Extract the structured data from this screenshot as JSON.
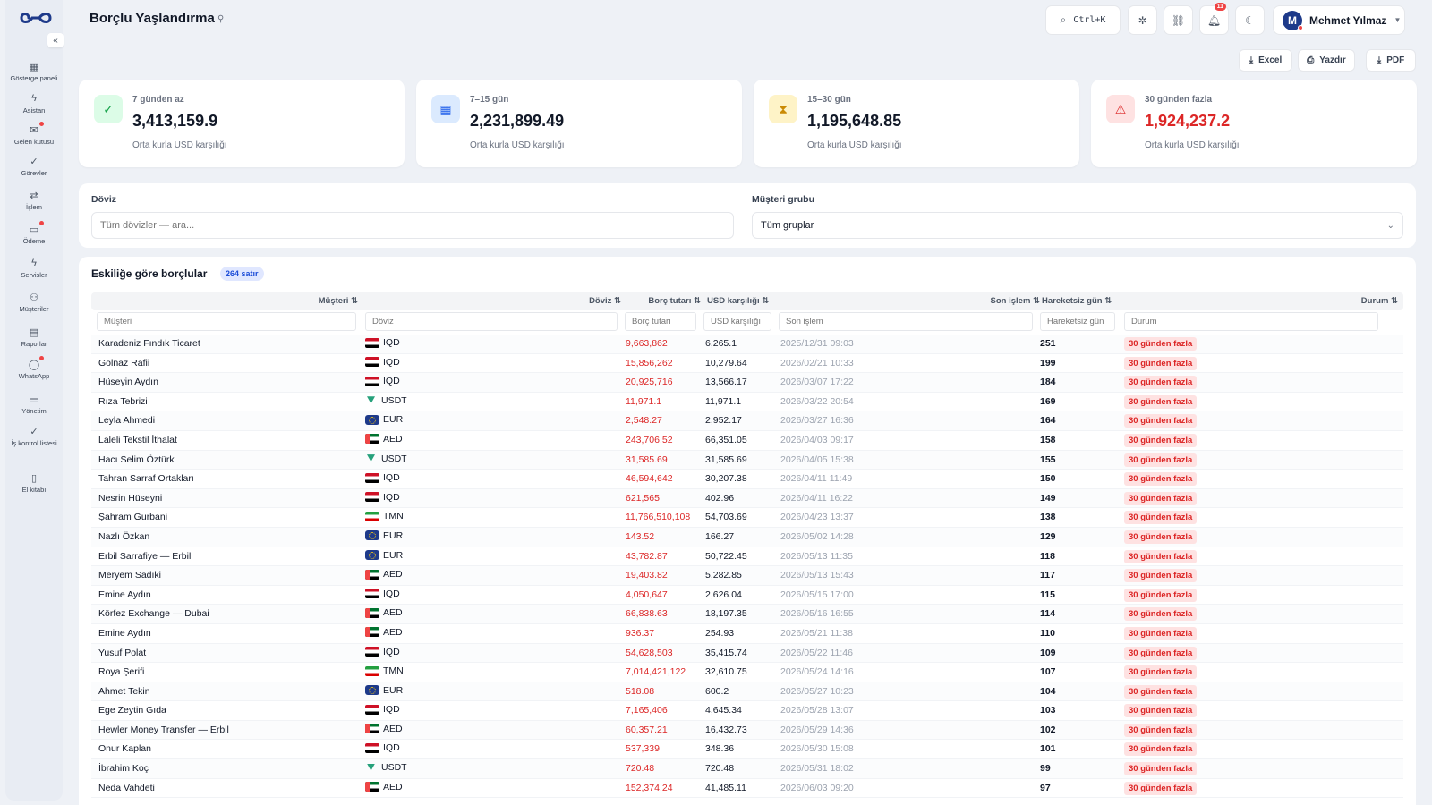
{
  "header": {
    "title": "Borçlu Yaşlandırma",
    "search_shortcut": "Ctrl+K",
    "notification_count": "11",
    "user_initial": "M",
    "user_name": "Mehmet Yılmaz"
  },
  "sidebar": {
    "items": [
      {
        "label": "Gösterge paneli",
        "icon": "grid-icon"
      },
      {
        "label": "Asistan",
        "icon": "bolt-icon"
      },
      {
        "label": "Gelen kutusu",
        "icon": "inbox-icon"
      },
      {
        "label": "Görevler",
        "icon": "check-icon"
      },
      {
        "label": "İşlem",
        "icon": "swap-icon"
      },
      {
        "label": "Ödeme",
        "icon": "wallet-icon"
      },
      {
        "label": "Servisler",
        "icon": "bolt-icon"
      },
      {
        "label": "Müşteriler",
        "icon": "users-icon"
      },
      {
        "label": "Raporlar",
        "icon": "document-icon"
      },
      {
        "label": "WhatsApp",
        "icon": "chat-icon"
      },
      {
        "label": "Yönetim",
        "icon": "sliders-icon"
      },
      {
        "label": "İş kontrol listesi",
        "icon": "checklist-icon"
      },
      {
        "label": "El kitabı",
        "icon": "book-icon"
      }
    ]
  },
  "toolbar": {
    "excel_label": "Excel",
    "print_label": "Yazdır",
    "pdf_label": "PDF"
  },
  "cards": [
    {
      "label": "7 günden az",
      "value": "3,413,159.9",
      "sub": "Orta kurla USD karşılığı",
      "color": "#16a34a",
      "bg": "#dcfce7",
      "icon": "check-circle-icon"
    },
    {
      "label": "7–15 gün",
      "value": "2,231,899.49",
      "sub": "Orta kurla USD karşılığı",
      "color": "#2563eb",
      "bg": "#dbeafe",
      "icon": "calendar-icon"
    },
    {
      "label": "15–30 gün",
      "value": "1,195,648.85",
      "sub": "Orta kurla USD karşılığı",
      "color": "#ca8a04",
      "bg": "#fef3c7",
      "icon": "hourglass-icon"
    },
    {
      "label": "30 günden fazla",
      "value": "1,924,237.2",
      "sub": "Orta kurla USD karşılığı",
      "color": "#dc2626",
      "bg": "#fee2e2",
      "icon": "warning-icon"
    }
  ],
  "filters": {
    "currency_label": "Döviz",
    "currency_placeholder": "Tüm dövizler — ara...",
    "group_label": "Müşteri grubu",
    "group_value": "Tüm gruplar"
  },
  "table": {
    "title": "Eskiliğe göre borçlular",
    "count": "264 satır",
    "columns": {
      "musteri": "Müşteri ⇅",
      "doviz": "Döviz ⇅",
      "borc": "Borç tutarı ⇅",
      "usd": "USD karşılığı ⇅",
      "son": "Son işlem ⇅",
      "gun": "Hareketsiz gün ⇅",
      "durum": "Durum ⇅"
    },
    "filter_placeholders": {
      "musteri": "Müşteri",
      "doviz": "Döviz",
      "borc": "Borç tutarı",
      "usd": "USD karşılığı",
      "son": "Son işlem",
      "gun": "Hareketsiz gün",
      "durum": "Durum"
    },
    "rows": [
      {
        "name": "Karadeniz Fındık Ticaret",
        "cur": "IQD",
        "borc": "9,663,862",
        "usd": "6,265.1",
        "son": "2025/12/31 09:03",
        "gun": "251",
        "durum": "30 günden fazla"
      },
      {
        "name": "Golnaz Rafii",
        "cur": "IQD",
        "borc": "15,856,262",
        "usd": "10,279.64",
        "son": "2026/02/21 10:33",
        "gun": "199",
        "durum": "30 günden fazla"
      },
      {
        "name": "Hüseyin Aydın",
        "cur": "IQD",
        "borc": "20,925,716",
        "usd": "13,566.17",
        "son": "2026/03/07 17:22",
        "gun": "184",
        "durum": "30 günden fazla"
      },
      {
        "name": "Rıza Tebrizi",
        "cur": "USDT",
        "borc": "11,971.1",
        "usd": "11,971.1",
        "son": "2026/03/22 20:54",
        "gun": "169",
        "durum": "30 günden fazla"
      },
      {
        "name": "Leyla Ahmedi",
        "cur": "EUR",
        "borc": "2,548.27",
        "usd": "2,952.17",
        "son": "2026/03/27 16:36",
        "gun": "164",
        "durum": "30 günden fazla"
      },
      {
        "name": "Laleli Tekstil İthalat",
        "cur": "AED",
        "borc": "243,706.52",
        "usd": "66,351.05",
        "son": "2026/04/03 09:17",
        "gun": "158",
        "durum": "30 günden fazla"
      },
      {
        "name": "Hacı Selim Öztürk",
        "cur": "USDT",
        "borc": "31,585.69",
        "usd": "31,585.69",
        "son": "2026/04/05 15:38",
        "gun": "155",
        "durum": "30 günden fazla"
      },
      {
        "name": "Tahran Sarraf Ortakları",
        "cur": "IQD",
        "borc": "46,594,642",
        "usd": "30,207.38",
        "son": "2026/04/11 11:49",
        "gun": "150",
        "durum": "30 günden fazla"
      },
      {
        "name": "Nesrin Hüseyni",
        "cur": "IQD",
        "borc": "621,565",
        "usd": "402.96",
        "son": "2026/04/11 16:22",
        "gun": "149",
        "durum": "30 günden fazla"
      },
      {
        "name": "Şahram Gurbani",
        "cur": "TMN",
        "borc": "11,766,510,108",
        "usd": "54,703.69",
        "son": "2026/04/23 13:37",
        "gun": "138",
        "durum": "30 günden fazla"
      },
      {
        "name": "Nazlı Özkan",
        "cur": "EUR",
        "borc": "143.52",
        "usd": "166.27",
        "son": "2026/05/02 14:28",
        "gun": "129",
        "durum": "30 günden fazla"
      },
      {
        "name": "Erbil Sarrafiye — Erbil",
        "cur": "EUR",
        "borc": "43,782.87",
        "usd": "50,722.45",
        "son": "2026/05/13 11:35",
        "gun": "118",
        "durum": "30 günden fazla"
      },
      {
        "name": "Meryem Sadıki",
        "cur": "AED",
        "borc": "19,403.82",
        "usd": "5,282.85",
        "son": "2026/05/13 15:43",
        "gun": "117",
        "durum": "30 günden fazla"
      },
      {
        "name": "Emine Aydın",
        "cur": "IQD",
        "borc": "4,050,647",
        "usd": "2,626.04",
        "son": "2026/05/15 17:00",
        "gun": "115",
        "durum": "30 günden fazla"
      },
      {
        "name": "Körfez Exchange — Dubai",
        "cur": "AED",
        "borc": "66,838.63",
        "usd": "18,197.35",
        "son": "2026/05/16 16:55",
        "gun": "114",
        "durum": "30 günden fazla"
      },
      {
        "name": "Emine Aydın",
        "cur": "AED",
        "borc": "936.37",
        "usd": "254.93",
        "son": "2026/05/21 11:38",
        "gun": "110",
        "durum": "30 günden fazla"
      },
      {
        "name": "Yusuf Polat",
        "cur": "IQD",
        "borc": "54,628,503",
        "usd": "35,415.74",
        "son": "2026/05/22 11:46",
        "gun": "109",
        "durum": "30 günden fazla"
      },
      {
        "name": "Roya Şerifi",
        "cur": "TMN",
        "borc": "7,014,421,122",
        "usd": "32,610.75",
        "son": "2026/05/24 14:16",
        "gun": "107",
        "durum": "30 günden fazla"
      },
      {
        "name": "Ahmet Tekin",
        "cur": "EUR",
        "borc": "518.08",
        "usd": "600.2",
        "son": "2026/05/27 10:23",
        "gun": "104",
        "durum": "30 günden fazla"
      },
      {
        "name": "Ege Zeytin Gıda",
        "cur": "IQD",
        "borc": "7,165,406",
        "usd": "4,645.34",
        "son": "2026/05/28 13:07",
        "gun": "103",
        "durum": "30 günden fazla"
      },
      {
        "name": "Hewler Money Transfer — Erbil",
        "cur": "AED",
        "borc": "60,357.21",
        "usd": "16,432.73",
        "son": "2026/05/29 14:36",
        "gun": "102",
        "durum": "30 günden fazla"
      },
      {
        "name": "Onur Kaplan",
        "cur": "IQD",
        "borc": "537,339",
        "usd": "348.36",
        "son": "2026/05/30 15:08",
        "gun": "101",
        "durum": "30 günden fazla"
      },
      {
        "name": "İbrahim Koç",
        "cur": "USDT",
        "borc": "720.48",
        "usd": "720.48",
        "son": "2026/05/31 18:02",
        "gun": "99",
        "durum": "30 günden fazla"
      },
      {
        "name": "Neda Vahdeti",
        "cur": "AED",
        "borc": "152,374.24",
        "usd": "41,485.11",
        "son": "2026/06/03 09:20",
        "gun": "97",
        "durum": "30 günden fazla"
      }
    ]
  }
}
